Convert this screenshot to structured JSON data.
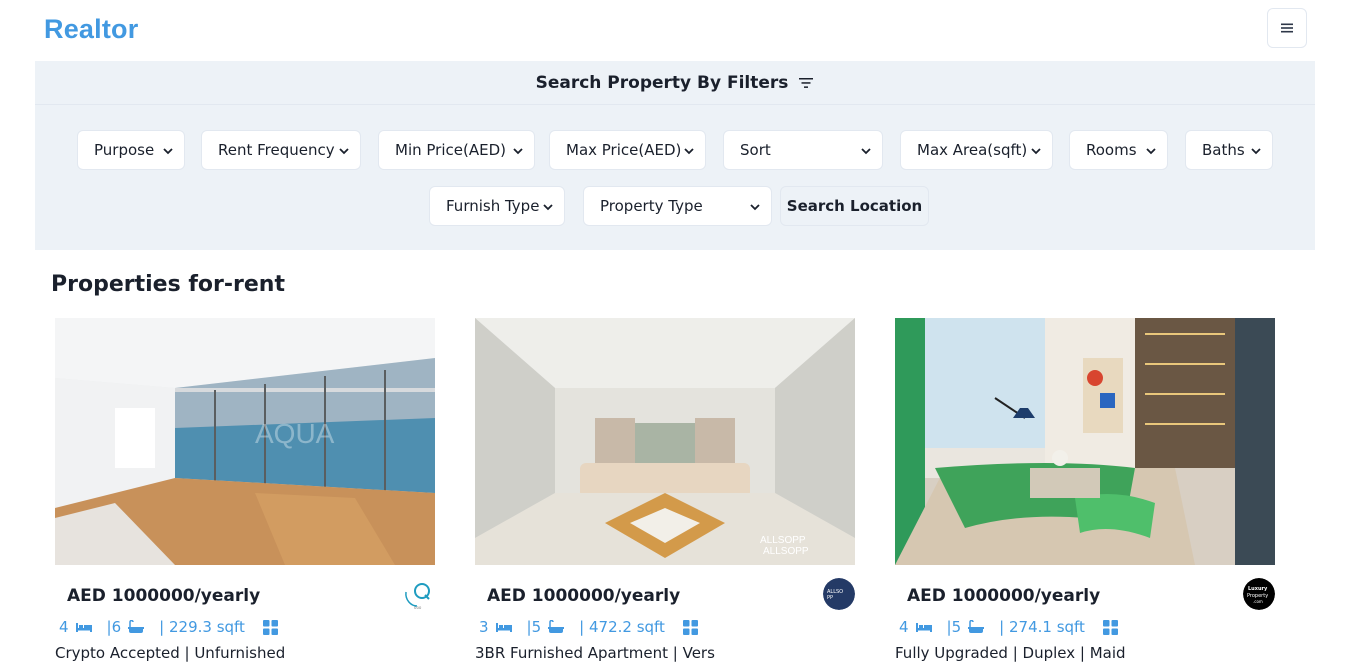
{
  "brand": "Realtor",
  "filters": {
    "heading": "Search Property By Filters",
    "selects": [
      {
        "label": "Purpose"
      },
      {
        "label": "Rent Frequency"
      },
      {
        "label": "Min Price(AED)"
      },
      {
        "label": "Max Price(AED)"
      },
      {
        "label": "Sort"
      },
      {
        "label": "Max Area(sqft)"
      },
      {
        "label": "Rooms"
      },
      {
        "label": "Baths"
      },
      {
        "label": "Furnish Type"
      },
      {
        "label": "Property Type"
      }
    ],
    "search_location_label": "Search Location"
  },
  "section_title": "Properties for-rent",
  "properties": [
    {
      "price": "AED 1000000/yearly",
      "rooms": "4",
      "baths": "|6",
      "area": "| 229.3 sqft",
      "title": "Crypto Accepted | Unfurnished",
      "agency_icon": "aqua-logo-icon"
    },
    {
      "price": "AED 1000000/yearly",
      "rooms": "3",
      "baths": "|5",
      "area": "| 472.2 sqft",
      "title": "3BR Furnished Apartment | Vers",
      "agency_icon": "allsopp-logo-icon"
    },
    {
      "price": "AED 1000000/yearly",
      "rooms": "4",
      "baths": "|5",
      "area": "| 274.1 sqft",
      "title": "Fully Upgraded | Duplex | Maid",
      "agency_icon": "luxury-property-logo-icon"
    }
  ],
  "colors": {
    "accent": "#4299e1",
    "panel": "#edf2f7",
    "border": "#e2e8f0"
  }
}
